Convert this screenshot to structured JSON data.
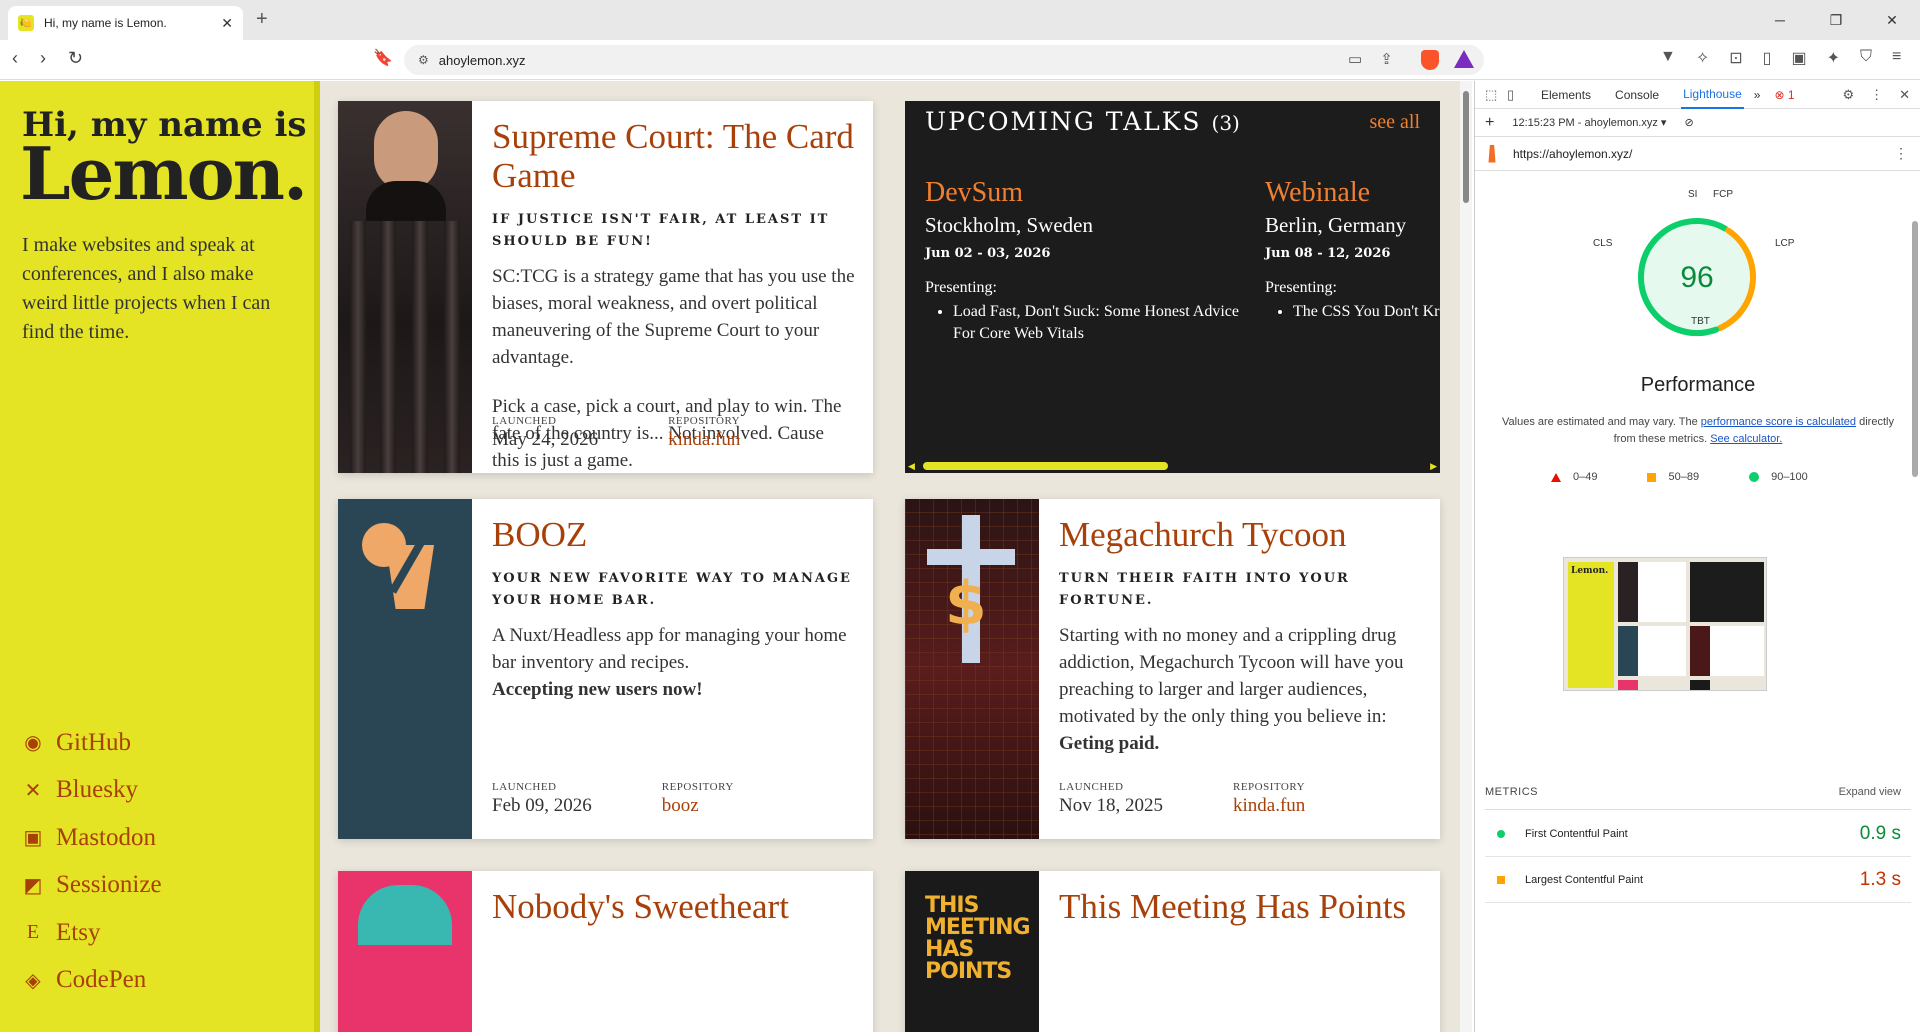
{
  "browser": {
    "tab_title": "Hi, my name is Lemon.",
    "new_tab": "+",
    "url": "ahoylemon.xyz"
  },
  "sidebar": {
    "greeting": "Hi, my name is",
    "name": "Lemon.",
    "intro": "I make websites and speak at conferences, and I also make weird little projects when I can find the time.",
    "links": [
      {
        "label": "GitHub",
        "icon": "github-icon"
      },
      {
        "label": "Bluesky",
        "icon": "butterfly-icon"
      },
      {
        "label": "Mastodon",
        "icon": "mastodon-icon"
      },
      {
        "label": "Sessionize",
        "icon": "sessionize-icon"
      },
      {
        "label": "Etsy",
        "icon": "etsy-icon"
      },
      {
        "label": "CodePen",
        "icon": "codepen-icon"
      }
    ]
  },
  "projects": [
    {
      "title": "Supreme Court: The Card Game",
      "tagline": "IF JUSTICE ISN'T FAIR, AT LEAST IT SHOULD BE FUN!",
      "desc1": "SC:TCG is a strategy game that has you use the biases, moral weakness, and overt political maneuvering of the Supreme Court to your advantage.",
      "desc2": "Pick a case, pick a court, and play to win. The fate of the country is... Not involved. Cause this is just a game.",
      "launched_label": "LAUNCHED",
      "launched": "May 24, 2026",
      "repo_label": "REPOSITORY",
      "repo": "kinda.fun"
    },
    {
      "title": "BOOZ",
      "tagline": "YOUR NEW FAVORITE WAY TO MANAGE YOUR HOME BAR.",
      "desc1": "A Nuxt/Headless app for managing your home bar inventory and recipes.",
      "desc_bold": "Accepting new users now!",
      "launched_label": "LAUNCHED",
      "launched": "Feb 09, 2026",
      "repo_label": "REPOSITORY",
      "repo": "booz"
    },
    {
      "title": "Megachurch Tycoon",
      "tagline": "TURN THEIR FAITH INTO YOUR FORTUNE.",
      "desc1": "Starting with no money and a crippling drug addiction, Megachurch Tycoon will have you preaching to larger and larger audiences, motivated by the only thing you believe in: ",
      "desc_bold": "Geting paid.",
      "launched_label": "LAUNCHED",
      "launched": "Nov 18, 2025",
      "repo_label": "REPOSITORY",
      "repo": "kinda.fun"
    },
    {
      "title": "Nobody's Sweetheart"
    },
    {
      "title": "This Meeting Has Points",
      "art_text": "THIS MEETING HAS POINTS"
    }
  ],
  "talks": {
    "heading": "UPCOMING TALKS",
    "count": "(3)",
    "see_all": "see all",
    "items": [
      {
        "event": "DevSum",
        "location": "Stockholm, Sweden",
        "date": "Jun 02 - 03, 2026",
        "presenting_label": "Presenting:",
        "talk": "Load Fast, Don't Suck: Some Honest Advice For Core Web Vitals"
      },
      {
        "event": "Webinale",
        "location": "Berlin, Germany",
        "date": "Jun 08 - 12, 2026",
        "presenting_label": "Presenting:",
        "talk": "The CSS You Don't Kr"
      }
    ],
    "scroll_fraction": 0.49
  },
  "devtools": {
    "tabs": [
      "Elements",
      "Console",
      "Lighthouse"
    ],
    "active_tab": "Lighthouse",
    "more": "»",
    "error_count": "1",
    "report_time": "12:15:23 PM - ahoylemon.xyz",
    "report_url": "https://ahoylemon.xyz/",
    "score": "96",
    "score_value": 96,
    "gauge_labels": {
      "si": "SI",
      "fcp": "FCP",
      "lcp": "LCP",
      "tbt": "TBT",
      "cls": "CLS"
    },
    "category": "Performance",
    "note_prefix": "Values are estimated and may vary. The ",
    "note_link1": "performance score is calculated",
    "note_mid": " directly from these metrics. ",
    "note_link2": "See calculator.",
    "legend": [
      "0–49",
      "50–89",
      "90–100"
    ],
    "metrics_heading": "METRICS",
    "expand": "Expand view",
    "metrics": [
      {
        "name": "First Contentful Paint",
        "value": "0.9 s",
        "status": "good"
      },
      {
        "name": "Largest Contentful Paint",
        "value": "1.3 s",
        "status": "average"
      }
    ],
    "colors": {
      "good": "#0cce6b",
      "average": "#ffa400",
      "poor": "#eb0f00"
    }
  }
}
